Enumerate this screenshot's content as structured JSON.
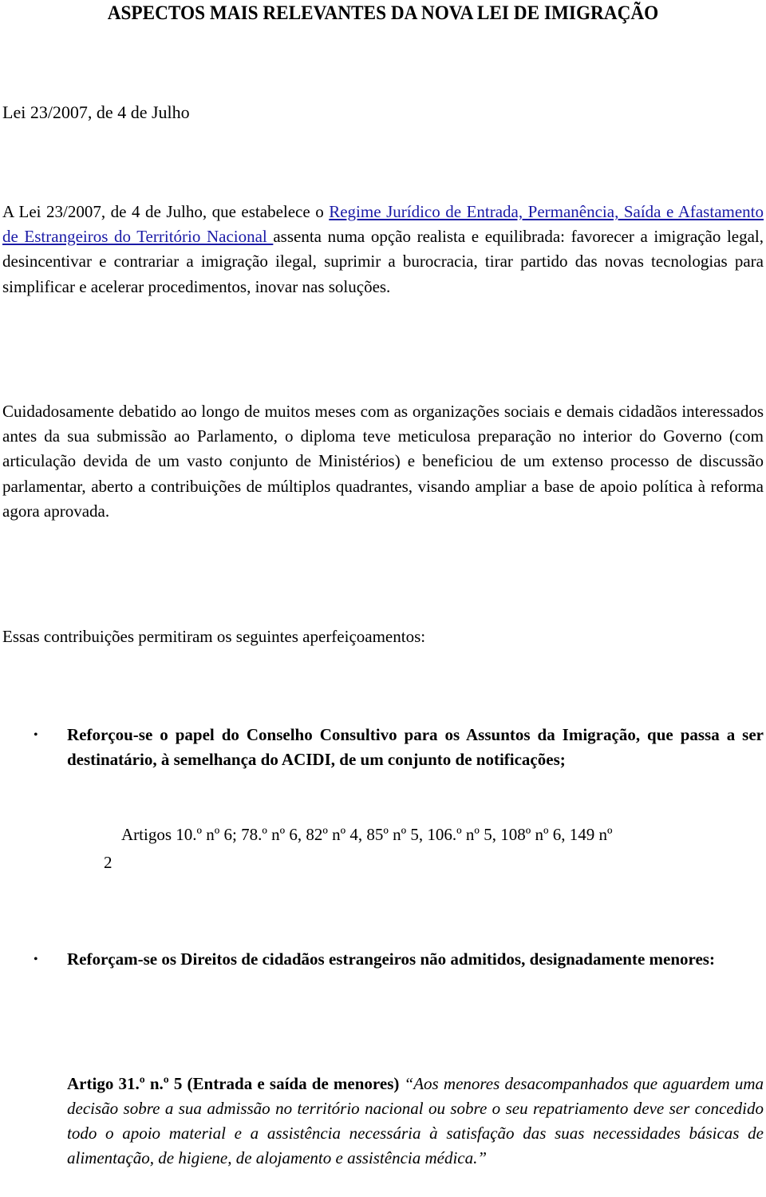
{
  "document": {
    "title": "ASPECTOS MAIS RELEVANTES DA NOVA LEI DE IMIGRAÇÃO",
    "subtitle": "Lei 23/2007, de 4 de Julho",
    "intro": {
      "before_link": "A Lei 23/2007, de 4 de Julho, que estabelece o ",
      "link_text": "Regime Jurídico de Entrada, Permanência, Saída e Afastamento de Estrangeiros do Território Nacional ",
      "after_link": " assenta numa opção realista e equilibrada: favorecer a imigração legal, desincentivar e contrariar a imigração ilegal, suprimir a burocracia, tirar partido das novas tecnologias para simplificar e acelerar procedimentos, inovar nas soluções."
    },
    "paragraph2": "Cuidadosamente debatido ao longo de muitos meses com as organizações sociais e demais cidadãos interessados antes da sua submissão ao Parlamento, o diploma teve meticulosa preparação no interior do Governo (com articulação devida de um vasto conjunto de Ministérios) e beneficiou de um extenso processo de discussão parlamentar, aberto a contribuições de múltiplos quadrantes, visando ampliar a base de apoio política à reforma agora aprovada.",
    "paragraph3": "Essas contribuições permitiram os seguintes aperfeiçoamentos:",
    "bullets": [
      {
        "symbol": "•",
        "text": "Reforçou-se o papel do Conselho Consultivo para os Assuntos da Imigração, que passa a ser destinatário, à semelhança do ACIDI, de um conjunto de notificações;"
      },
      {
        "symbol": "•",
        "text": "Reforçam-se os Direitos de cidadãos estrangeiros não admitidos, designadamente menores:"
      }
    ],
    "articles_ref": "Artigos 10.º nº 6;  78.º nº 6,  82º nº 4, 85º nº 5, 106.º nº 5, 108º nº 6, 149 nº",
    "page_number": "2",
    "article31": {
      "heading": "Artigo 31.º n.º 5 (Entrada e saída de menores)",
      "quote": "“Aos menores desacompanhados que aguardem uma decisão sobre a sua admissão no território nacional ou sobre o seu repatriamento deve ser concedido todo o apoio material e a assistência necessária à satisfação das suas necessidades básicas de alimentação, de higiene, de alojamento e assistência médica.”"
    }
  },
  "colors": {
    "text": "#000000",
    "link": "#1a1aa6",
    "background": "#ffffff"
  }
}
